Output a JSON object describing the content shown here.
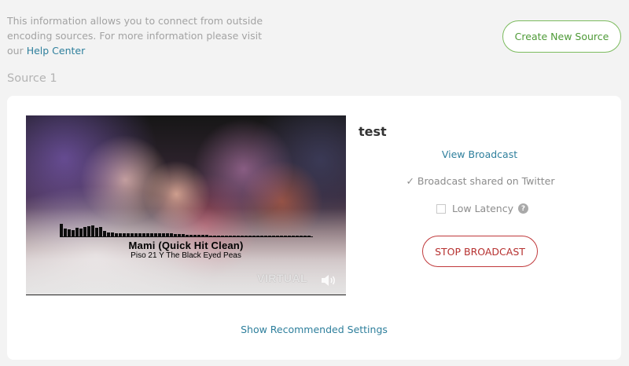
{
  "intro": {
    "text": "This information allows you to connect from outside encoding sources. For more information please visit our ",
    "link_label": "Help Center"
  },
  "header": {
    "create_button_label": "Create New Source"
  },
  "source": {
    "heading": "Source 1",
    "title": "test",
    "view_broadcast_label": "View Broadcast",
    "twitter_status": "✓ Broadcast shared on Twitter",
    "low_latency_label": "Low Latency",
    "low_latency_checked": false,
    "help_icon_glyph": "?",
    "stop_button_label": "STOP BROADCAST",
    "recommended_settings_label": "Show Recommended Settings"
  },
  "video": {
    "song_title": "Mami (Quick Hit Clean)",
    "song_artist": "Piso 21 Y The Black Eyed Peas",
    "watermark": "VIRTUAL",
    "volume_icon": "volume-icon",
    "equalizer_levels": [
      0.8,
      0.5,
      0.45,
      0.4,
      0.55,
      0.5,
      0.6,
      0.65,
      0.7,
      0.55,
      0.6,
      0.35,
      0.25,
      0.25,
      0.22,
      0.2,
      0.2,
      0.22,
      0.22,
      0.2,
      0.2,
      0.2,
      0.22,
      0.2,
      0.18,
      0.2,
      0.18,
      0.2,
      0.18,
      0.15,
      0.15,
      0.14,
      0.12,
      0.1,
      0.1,
      0.08,
      0.08,
      0.08,
      0.06,
      0.06,
      0.05,
      0.05,
      0.05,
      0.05,
      0.05,
      0.05,
      0.05,
      0.05,
      0.05,
      0.05,
      0.05,
      0.05,
      0.05,
      0.05,
      0.05,
      0.05,
      0.05,
      0.05,
      0.05,
      0.05,
      0.05,
      0.05,
      0.05,
      0.05
    ]
  },
  "colors": {
    "link": "#2e7f9c",
    "create_button": "#4e9a37",
    "stop_button": "#b6302f",
    "page_background": "#f3f3f3"
  }
}
